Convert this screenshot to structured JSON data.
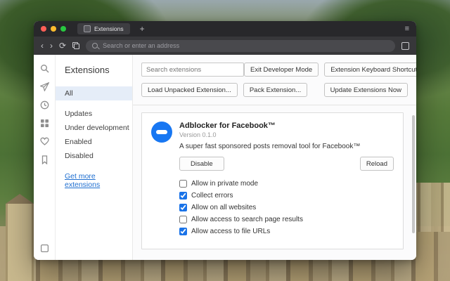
{
  "theme": {
    "accent": "#1a73e8",
    "extension_icon_bg": "#1877f2",
    "titlebar_bg": "#28282b"
  },
  "chrome": {
    "tab_title": "Extensions",
    "address_placeholder": "Search or enter an address",
    "icons": {
      "back": "‹",
      "forward": "›",
      "reload": "⟳",
      "new_tab": "+",
      "menu": "≡"
    }
  },
  "sidebar": {
    "title": "Extensions",
    "items": [
      {
        "label": "All",
        "selected": true
      },
      {
        "label": "Updates",
        "selected": false
      },
      {
        "label": "Under development",
        "selected": false
      },
      {
        "label": "Enabled",
        "selected": false
      },
      {
        "label": "Disabled",
        "selected": false
      }
    ],
    "link_label": "Get more extensions"
  },
  "main": {
    "search_placeholder": "Search extensions",
    "exit_dev_label": "Exit Developer Mode",
    "shortcuts_label": "Extension Keyboard Shortcuts",
    "load_unpacked_label": "Load Unpacked Extension...",
    "pack_label": "Pack Extension...",
    "update_label": "Update Extensions Now",
    "extension": {
      "name": "Adblocker for Facebook™",
      "version": "Version 0.1.0",
      "description": "A super fast sponsored posts removal tool for Facebook™",
      "disable_label": "Disable",
      "reload_label": "Reload",
      "options": [
        {
          "label": "Allow in private mode",
          "checked": false
        },
        {
          "label": "Collect errors",
          "checked": true
        },
        {
          "label": "Allow on all websites",
          "checked": true
        },
        {
          "label": "Allow access to search page results",
          "checked": false
        },
        {
          "label": "Allow access to file URLs",
          "checked": true
        }
      ]
    }
  }
}
